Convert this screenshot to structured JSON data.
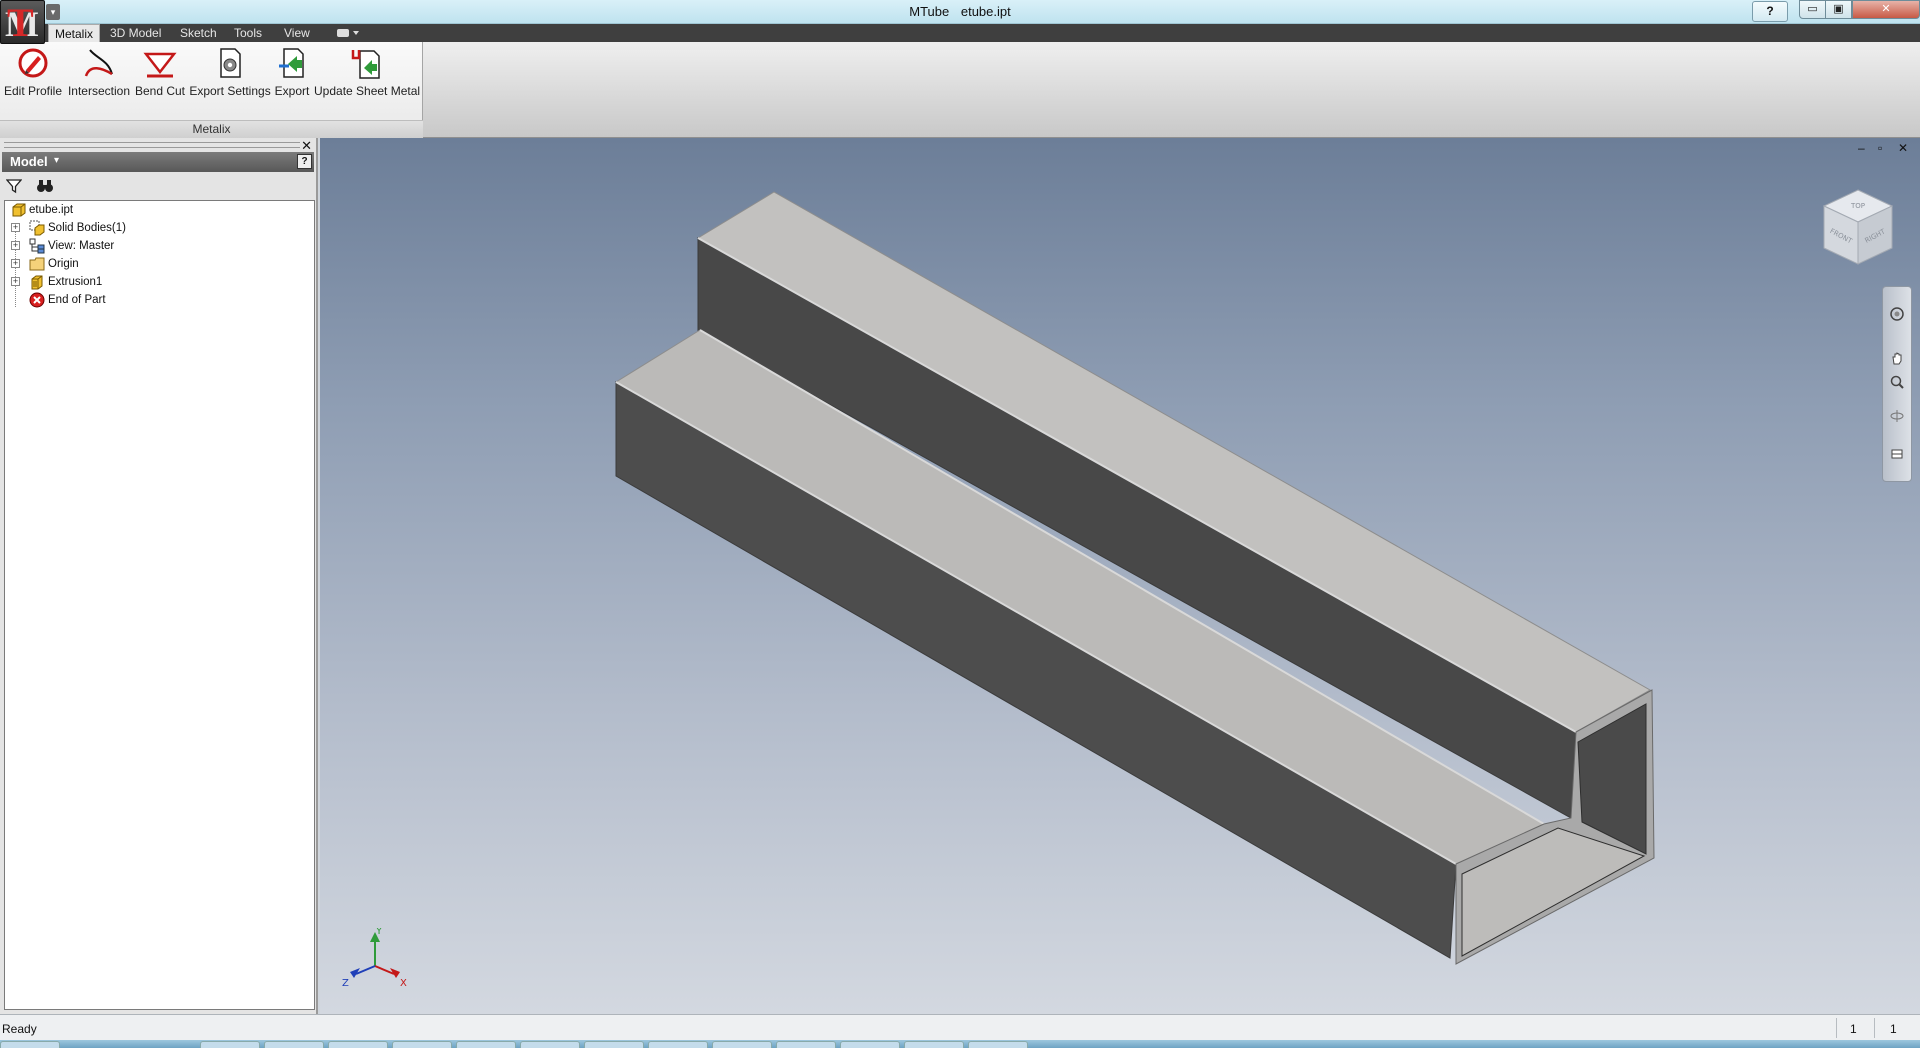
{
  "window": {
    "app_name": "MTube",
    "document_name": "etube.ipt",
    "help_label": "?",
    "minimize": "▭",
    "maximize": "▣",
    "close": "✕"
  },
  "qat": {
    "arrow": "▾"
  },
  "tabs": [
    {
      "label": "Metalix",
      "active": true
    },
    {
      "label": "3D Model",
      "active": false
    },
    {
      "label": "Sketch",
      "active": false
    },
    {
      "label": "Tools",
      "active": false
    },
    {
      "label": "View",
      "active": false
    }
  ],
  "ribbon": {
    "panel_title": "Metalix",
    "buttons": [
      {
        "label": "Edit Profile",
        "icon": "edit-profile-icon"
      },
      {
        "label": "Intersection",
        "icon": "intersection-icon"
      },
      {
        "label": "Bend Cut",
        "icon": "bend-cut-icon"
      },
      {
        "label": "Export Settings",
        "icon": "export-settings-icon"
      },
      {
        "label": "Export",
        "icon": "export-icon"
      },
      {
        "label": "Update Sheet Metal",
        "icon": "update-sheet-metal-icon"
      }
    ]
  },
  "browser": {
    "title": "Model",
    "title_arrow": "▾",
    "help": "?",
    "close": "✕",
    "tree": [
      {
        "label": "etube.ipt",
        "icon": "part-file-icon",
        "expander": ""
      },
      {
        "label": "Solid Bodies(1)",
        "icon": "solid-bodies-icon",
        "expander": "+"
      },
      {
        "label": "View: Master",
        "icon": "view-rep-icon",
        "expander": "+"
      },
      {
        "label": "Origin",
        "icon": "folder-icon",
        "expander": "+"
      },
      {
        "label": "Extrusion1",
        "icon": "extrusion-icon",
        "expander": "+"
      },
      {
        "label": "End of Part",
        "icon": "end-of-part-icon",
        "expander": ""
      }
    ]
  },
  "viewport": {
    "controls": {
      "minimize": "–",
      "restore": "▫",
      "close": "✕"
    },
    "viewcube_faces": {
      "top": "TOP",
      "front": "FRONT",
      "right": "RIGHT"
    },
    "triad": {
      "x": "X",
      "y": "Y",
      "z": "Z"
    }
  },
  "colors": {
    "model_light": "#bebebe",
    "model_dark": "#4a4a4a",
    "ribbon_tab_bg": "#3f3f3f",
    "close_red": "#c75a45"
  },
  "status": {
    "text": "Ready",
    "num1": "1",
    "num2": "1"
  }
}
